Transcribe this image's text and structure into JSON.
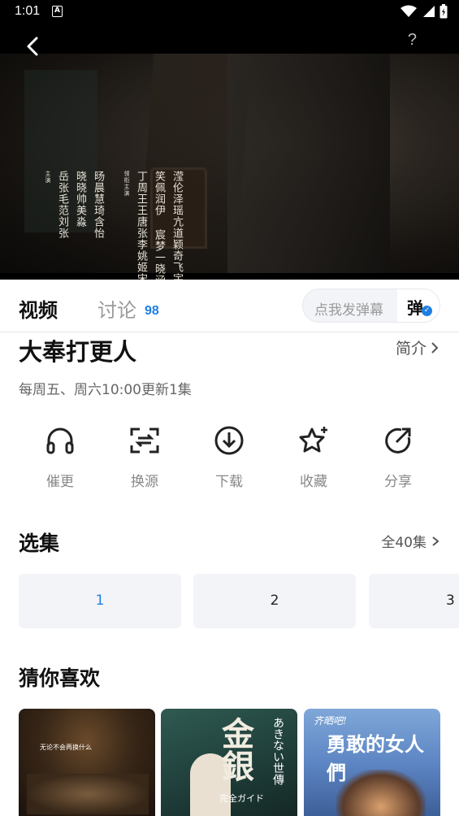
{
  "status_bar": {
    "time": "1:01",
    "notification_letter": "A"
  },
  "player": {
    "help_label": "?",
    "credits": [
      {
        "tag": "主演",
        "columns": [
          "岳张毛范刘张",
          "晓晓帅美淼",
          "旸晨慧琦含怡"
        ]
      },
      {
        "tag": "领衔主演",
        "columns": [
          "丁周王王唐张李姚姬宋魏",
          "笑佩润伊 宸梦一晓涵子",
          "滢伦泽瑶亢道颖奇飞宇昕"
        ]
      }
    ]
  },
  "tabs": {
    "video": "视频",
    "discuss": "讨论",
    "discuss_count": "98",
    "danmaku_placeholder": "点我发弹幕",
    "danmaku_button": "弹"
  },
  "show": {
    "title": "大奉打更人",
    "intro_label": "简介",
    "update_info": "每周五、周六10:00更新1集"
  },
  "actions": [
    {
      "label": "催更",
      "icon": "headphones-icon"
    },
    {
      "label": "换源",
      "icon": "switch-source-icon"
    },
    {
      "label": "下载",
      "icon": "download-icon"
    },
    {
      "label": "收藏",
      "icon": "star-icon"
    },
    {
      "label": "分享",
      "icon": "share-icon"
    }
  ],
  "episodes": {
    "title": "选集",
    "all_label": "全40集",
    "items": [
      "1",
      "2",
      "3"
    ],
    "active_color": "#1f7fe0"
  },
  "recommend": {
    "title": "猜你喜欢",
    "cards": [
      {
        "overlay_text": "无论不会再换什么"
      },
      {
        "overlay_big": "金銀",
        "overlay_side": "あきない世傳",
        "overlay_sub": "完全ガイド"
      },
      {
        "overlay_top": "齐晒吧!",
        "overlay_big": "勇敢的女人們"
      }
    ]
  }
}
